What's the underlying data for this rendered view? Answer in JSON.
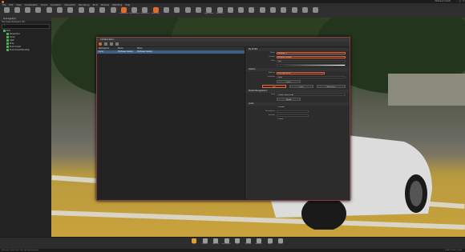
{
  "app": {
    "title": "",
    "right_label": "Multiuser Context"
  },
  "menubar": [
    "File",
    "Edit",
    "View",
    "Visualization",
    "Scene",
    "Animation",
    "Interaction",
    "Rendering",
    "Tools",
    "Window",
    "Web Blog",
    "Help"
  ],
  "toolbar": [
    "",
    "",
    "",
    "",
    "",
    "",
    "",
    "",
    "",
    "",
    "",
    "Collaboration",
    "Measurement",
    "Annotations",
    "Bookmarks",
    "",
    "",
    "",
    "",
    "Lights Editor",
    "Clip Planes",
    "",
    "",
    "",
    "",
    "",
    "",
    "",
    "",
    ""
  ],
  "scenegraph": {
    "title": "Scenegraph",
    "menu": "File  Create  Multiselect  Edit",
    "search_placeholder": "",
    "items": [
      "Root",
      "Perspective",
      "Group",
      "Light",
      "Body",
      "Environment",
      "Environment Backdrop"
    ]
  },
  "dialog": {
    "title": "Collaboration",
    "columns": [
      "Participants",
      "Model",
      "Name"
    ],
    "rows": [
      [
        "Local",
        "Multiuser Session",
        "Multiuser Session"
      ]
    ],
    "profile": {
      "section": "My Profile",
      "name_label": "Name",
      "name_value": "Multiuser_1",
      "session_label": "Session",
      "session_value": "Multiuser Session",
      "color_label": "Color",
      "color_value": "Red"
    },
    "session": {
      "section": "Session",
      "address_label": "Address",
      "address_value": "192.168.100.20",
      "invitation_label": "Invitation",
      "invitation_value": "Send",
      "button_invite": "Invite",
      "button_join": "Join",
      "button_leave": "Leave",
      "button_start": "Start Server"
    },
    "model": {
      "section": "Model Management",
      "send_label": "Send",
      "send_value": "Current Scene to All",
      "button_upload": "Upload"
    },
    "audio": {
      "section": "Audio",
      "enable_label": "Enable",
      "microphone_label": "Microphone",
      "speaker_label": "Speaker",
      "mute_label": "Mute"
    }
  },
  "bottombar": [
    "Light",
    "Graphics",
    "Materials",
    "Environment",
    "Lens",
    "Clip Plane",
    "Ambience",
    "Sound",
    "Points"
  ],
  "status": {
    "left": "VFS 0.00 - 0.00 | 100 / 100 - 80 | No Selection",
    "right": "0.000 / 0.000 / 0.000"
  },
  "colors": {
    "accent": "#e0683a",
    "selection": "#3e5f8a",
    "dialog_border": "#8a3d3d"
  }
}
